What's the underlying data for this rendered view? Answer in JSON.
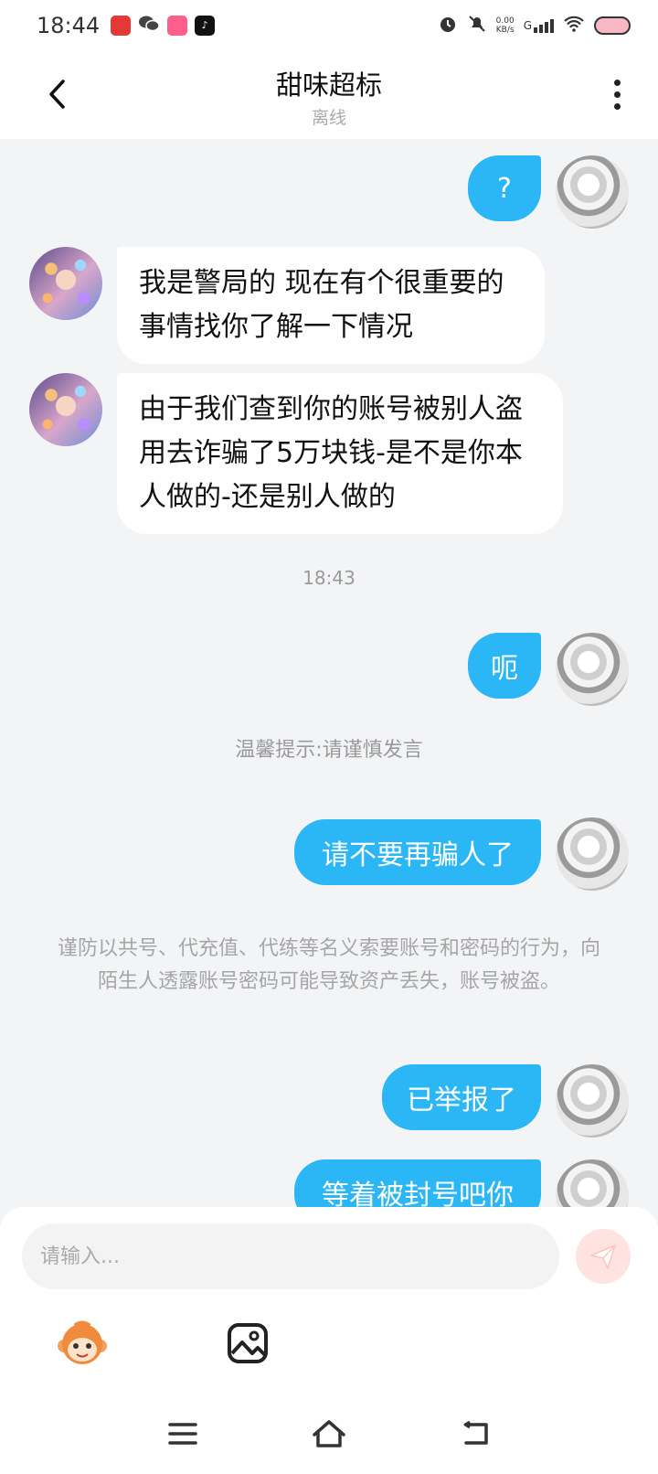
{
  "status_bar": {
    "time": "18:44",
    "net_speed": "0.00",
    "net_unit": "KB/s",
    "signal_label": "G"
  },
  "header": {
    "title": "甜味超标",
    "status": "离线"
  },
  "messages": [
    {
      "direction": "out",
      "text": "?"
    },
    {
      "direction": "in",
      "text": "我是警局的 现在有个很重要的事情找你了解一下情况"
    },
    {
      "direction": "in",
      "text": "由于我们查到你的账号被别人盗用去诈骗了5万块钱-是不是你本人做的-还是别人做的"
    },
    {
      "direction": "time",
      "text": "18:43"
    },
    {
      "direction": "out",
      "text": "呃"
    },
    {
      "direction": "tip",
      "text": "温馨提示:请谨慎发言"
    },
    {
      "direction": "out",
      "text": "请不要再骗人了"
    },
    {
      "direction": "notice",
      "text": "谨防以共号、代充值、代练等名义索要账号和密码的行为，向陌生人透露账号密码可能导致资产丢失，账号被盗。"
    },
    {
      "direction": "out",
      "text": "已举报了"
    },
    {
      "direction": "out",
      "text": "等着被封号吧你"
    }
  ],
  "input": {
    "placeholder": "请输入..."
  },
  "colors": {
    "outgoing_bubble": "#2bb6f6",
    "incoming_bubble": "#ffffff",
    "chat_background": "#f3f4f6",
    "send_button": "#ffe3e0"
  },
  "icons": {
    "back": "chevron-left-icon",
    "more": "more-vertical-icon",
    "send": "paper-plane-icon",
    "emoji": "monkey-emoji-icon",
    "image": "image-icon",
    "nav_menu": "menu-icon",
    "nav_home": "home-icon",
    "nav_back": "return-icon"
  }
}
